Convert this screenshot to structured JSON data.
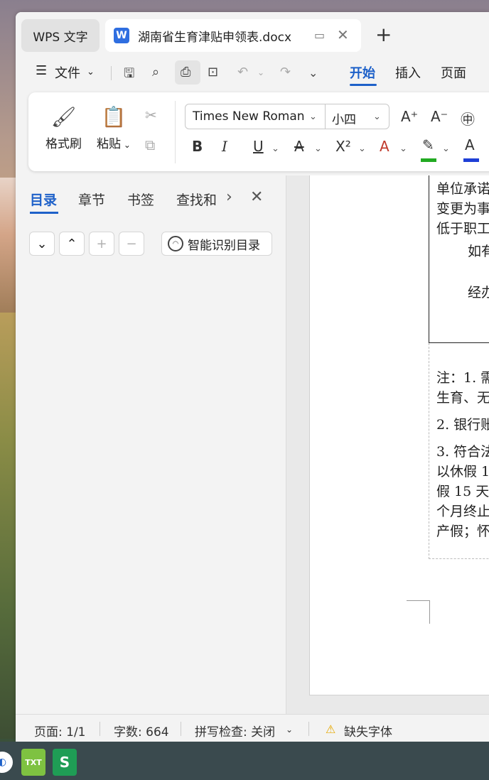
{
  "window": {
    "app_tab_label": "WPS 文字",
    "doc_tab_title": "湖南省生育津贴申领表.docx",
    "new_tab_glyph": "+"
  },
  "menu": {
    "file_label": "文件",
    "items": [
      "开始",
      "插入",
      "页面"
    ],
    "active_item": "开始"
  },
  "ribbon": {
    "format_painter": "格式刷",
    "paste": "粘贴",
    "font_name": "Times New Roman",
    "font_size": "小四",
    "bold": "B",
    "italic": "I",
    "underline": "U",
    "superscript": "X²",
    "font_color_letter": "A",
    "highlight_color": "#22aa22",
    "font_color": "#1e3fd6"
  },
  "nav": {
    "tabs": [
      "目录",
      "章节",
      "书签",
      "查找和"
    ],
    "active_tab": "目录",
    "smart_toc_button": "智能识别目录"
  },
  "document": {
    "table_lines": [
      "单位承诺",
      "变更为事",
      "低于职工",
      "如有",
      "经办"
    ],
    "notes_lines": [
      "注：1. 需",
      "生育、无",
      "2. 银行账",
      "3. 符合法",
      "以休假 1",
      "假 15 天",
      "个月终止",
      "产假；怀"
    ]
  },
  "status": {
    "page": "页面: 1/1",
    "words": "字数: 664",
    "spell": "拼写检查: 关闭",
    "missing_font": "缺失字体"
  },
  "taskbar": {
    "txt_label": "TXT",
    "sheets_label": "S"
  }
}
